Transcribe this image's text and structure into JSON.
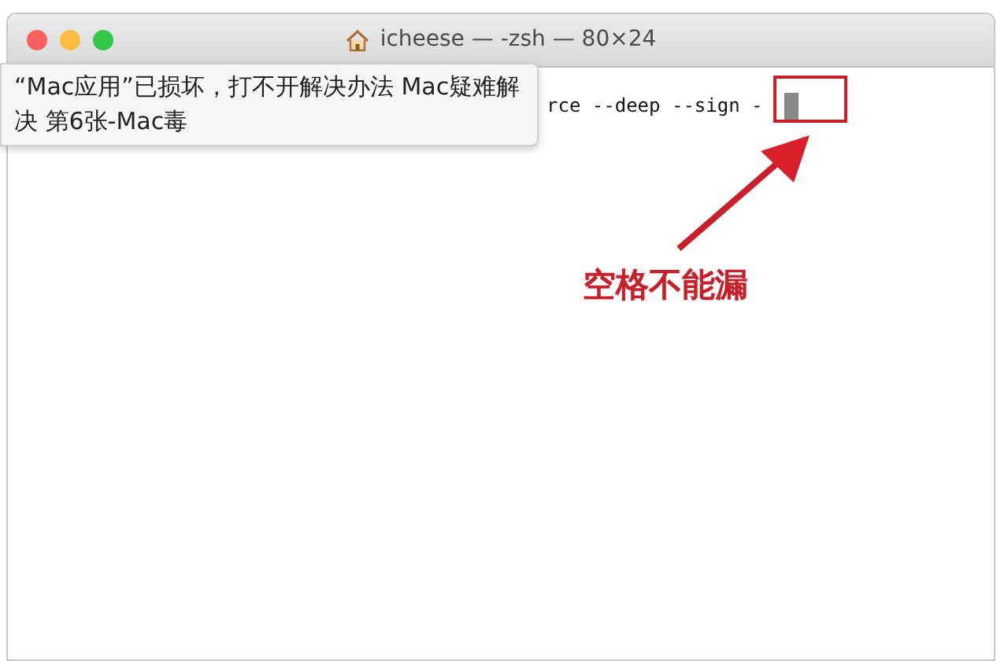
{
  "window": {
    "title": "icheese — -zsh — 80×24"
  },
  "terminal": {
    "lines": [
      "rce --deep --sign -"
    ]
  },
  "tooltip": {
    "text": "“Mac应用”已损坏，打不开解决办法 Mac疑难解决 第6张-Mac毒"
  },
  "annotation": {
    "text": "空格不能漏"
  }
}
